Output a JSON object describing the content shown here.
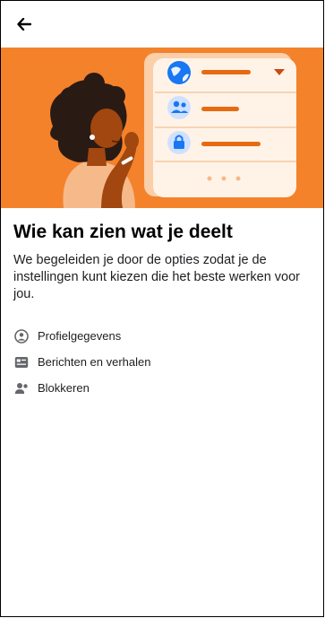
{
  "header": {
    "back_icon": "arrow-left-icon"
  },
  "hero": {
    "background": "#f4822b",
    "card_rows": [
      {
        "icon": "globe-icon"
      },
      {
        "icon": "people-icon"
      },
      {
        "icon": "lock-icon"
      }
    ]
  },
  "main": {
    "title": "Wie kan zien wat je deelt",
    "description": "We begeleiden je door de opties zodat je de instellingen kunt kiezen die het beste werken voor jou.",
    "options": [
      {
        "label": "Profielgegevens",
        "icon": "profile-circle-icon"
      },
      {
        "label": "Berichten en verhalen",
        "icon": "posts-card-icon"
      },
      {
        "label": "Blokkeren",
        "icon": "block-person-icon"
      }
    ]
  }
}
